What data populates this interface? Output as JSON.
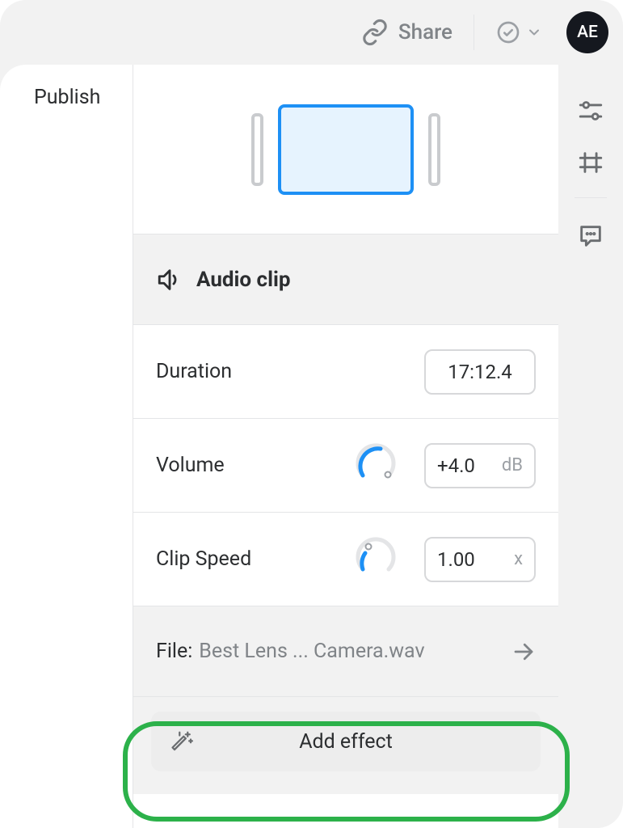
{
  "topbar": {
    "share_label": "Share",
    "avatar_initials": "AE"
  },
  "left": {
    "tab_label": "Publish"
  },
  "inspector": {
    "section_title": "Audio clip",
    "duration_label": "Duration",
    "duration_value": "17:12.4",
    "volume_label": "Volume",
    "volume_value": "+4.0",
    "volume_unit": "dB",
    "speed_label": "Clip Speed",
    "speed_value": "1.00",
    "speed_unit": "x",
    "file_label": "File:",
    "file_name": "Best Lens ... Camera.wav",
    "add_effect_label": "Add effect"
  }
}
